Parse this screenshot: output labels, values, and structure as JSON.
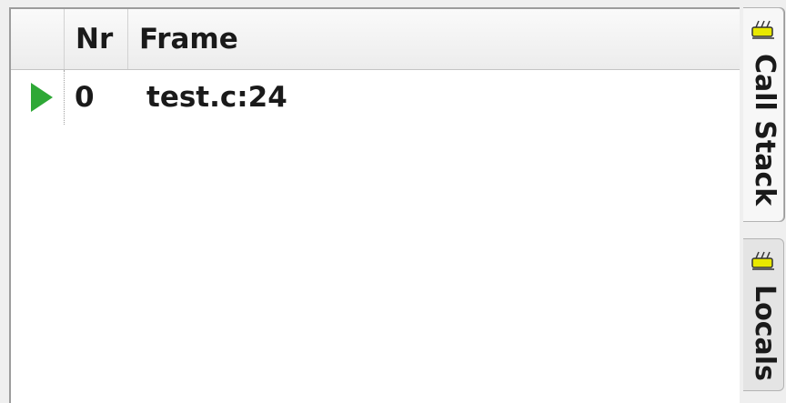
{
  "table": {
    "columns": [
      "",
      "Nr",
      "Frame"
    ],
    "rows": [
      {
        "nr": "0",
        "frame": "test.c:24",
        "current": true
      }
    ]
  },
  "tabs": [
    {
      "label": "Call Stack",
      "icon": "bug-icon",
      "active": true
    },
    {
      "label": "Locals",
      "icon": "bug-icon",
      "active": false
    }
  ],
  "colors": {
    "current_frame_arrow": "#2ea836",
    "bug_icon": "#e8e800"
  }
}
